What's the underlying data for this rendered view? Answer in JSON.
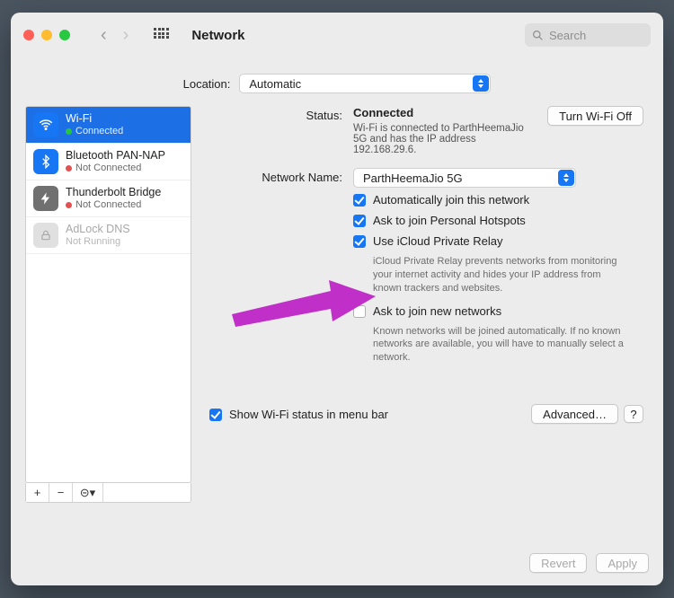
{
  "window": {
    "title": "Network"
  },
  "search": {
    "placeholder": "Search"
  },
  "location": {
    "label": "Location:",
    "value": "Automatic"
  },
  "sidebar": {
    "items": [
      {
        "name": "Wi-Fi",
        "status": "Connected",
        "color": "g"
      },
      {
        "name": "Bluetooth PAN-NAP",
        "status": "Not Connected",
        "color": "r"
      },
      {
        "name": "Thunderbolt Bridge",
        "status": "Not Connected",
        "color": "r"
      },
      {
        "name": "AdLock DNS",
        "status": "Not Running",
        "color": ""
      }
    ],
    "buttons": {
      "add": "+",
      "remove": "−",
      "actions": "⊝▾"
    }
  },
  "details": {
    "status_label": "Status:",
    "status_value": "Connected",
    "turn_off": "Turn Wi-Fi Off",
    "status_desc": "Wi-Fi is connected to ParthHeemaJio 5G and has the IP address 192.168.29.6.",
    "netname_label": "Network Name:",
    "netname_value": "ParthHeemaJio 5G",
    "opt_autojoin": "Automatically join this network",
    "opt_hotspot": "Ask to join Personal Hotspots",
    "opt_relay": "Use iCloud Private Relay",
    "relay_desc": "iCloud Private Relay prevents networks from monitoring your internet activity and hides your IP address from known trackers and websites.",
    "opt_asknew": "Ask to join new networks",
    "asknew_desc": "Known networks will be joined automatically. If no known networks are available, you will have to manually select a network.",
    "show_in_menubar": "Show Wi-Fi status in menu bar",
    "advanced": "Advanced…",
    "help": "?"
  },
  "footer": {
    "revert": "Revert",
    "apply": "Apply"
  }
}
